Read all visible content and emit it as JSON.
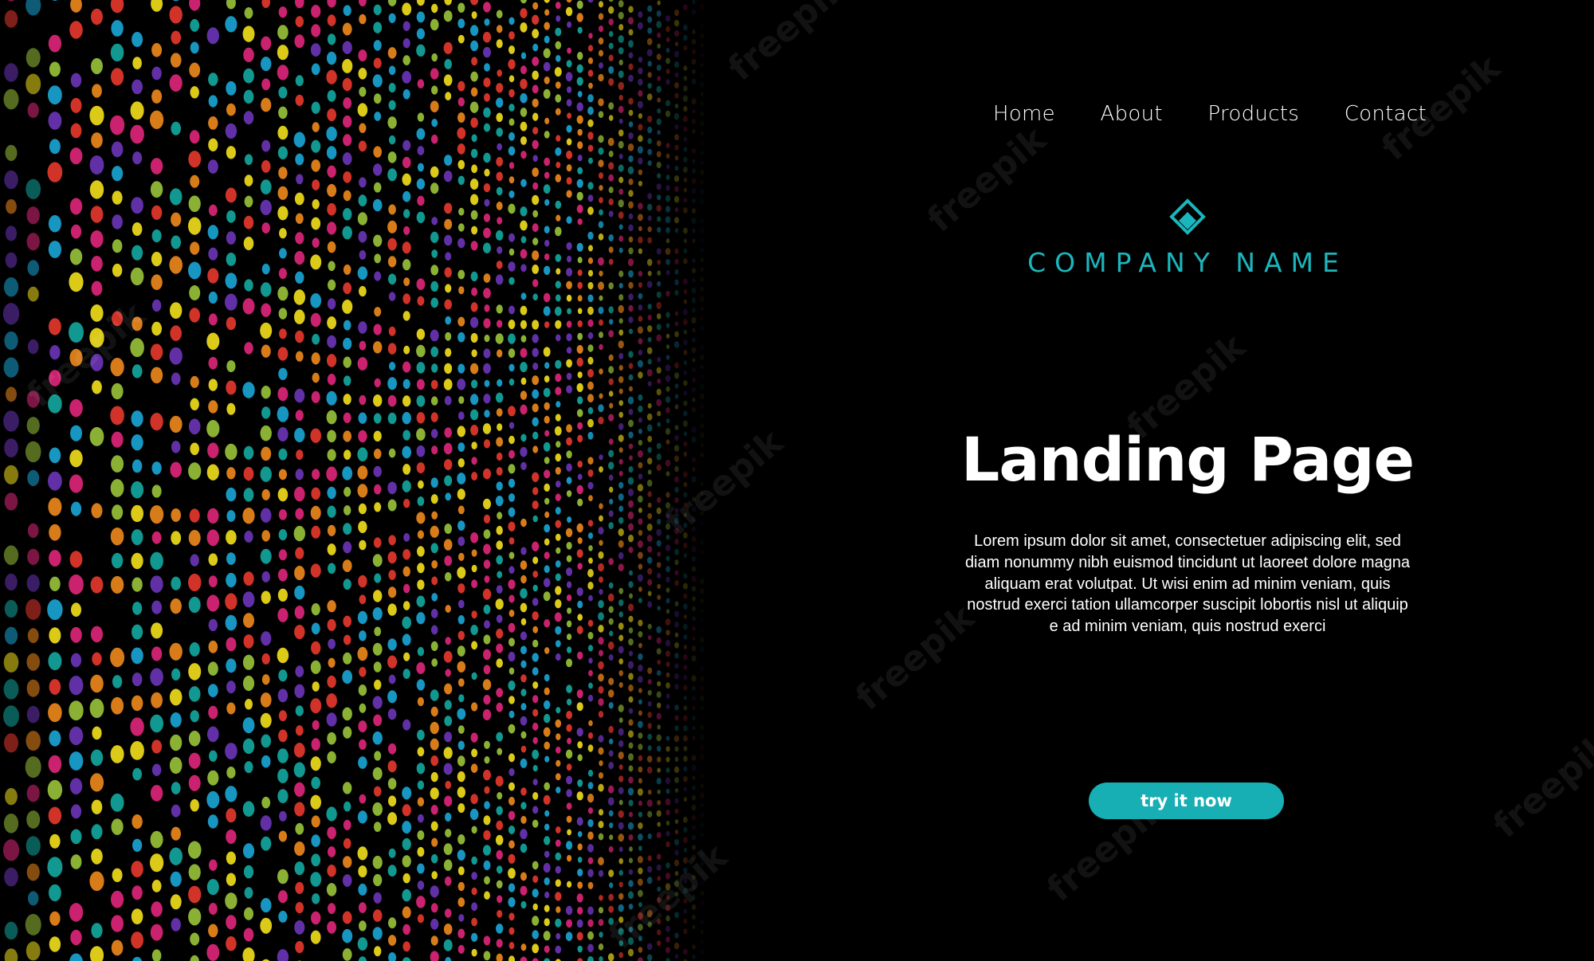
{
  "nav": {
    "items": [
      {
        "label": "Home"
      },
      {
        "label": "About"
      },
      {
        "label": "Products"
      },
      {
        "label": "Contact"
      }
    ]
  },
  "brand": {
    "company_name": "COMPANY NAME",
    "logo_icon": "diamond-logo-icon",
    "accent_color": "#1bb6bd"
  },
  "hero": {
    "title": "Landing Page",
    "body": "Lorem ipsum dolor sit amet, consectetuer adipiscing elit, sed diam nonummy nibh euismod tincidunt ut laoreet dolore magna aliquam erat volutpat. Ut wisi enim ad minim veniam, quis nostrud exerci tation ullamcorper suscipit lobortis nisl ut aliquip e ad minim veniam, quis nostrud exerci",
    "cta_label": "try it now"
  },
  "watermark": {
    "text": "freepik"
  },
  "decor": {
    "dot_colors": [
      "#e0267a",
      "#f4e01b",
      "#1aa6d6",
      "#6b35b8",
      "#e8392e",
      "#9ac43a",
      "#13a8a0",
      "#f08a1c"
    ]
  }
}
